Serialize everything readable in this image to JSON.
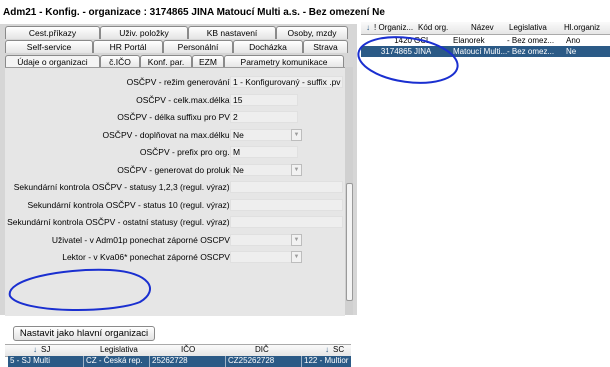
{
  "window": {
    "title": "Adm21 - Konfig. - organizace : 3174865  JINA    Matoucí Multi a.s.    - Bez omezení   Ne"
  },
  "tabs": {
    "row1": [
      "Cest.příkazy",
      "Uživ. položky",
      "KB nastavení",
      "Osoby, mzdy"
    ],
    "row2": [
      "Self-service",
      "HR Portál",
      "Personální",
      "Docházka",
      "Strava"
    ],
    "row3": [
      "Údaje o organizaci",
      "č.IČO",
      "Konf. par.",
      "EZM",
      "Parametry komunikace"
    ]
  },
  "form": {
    "fields": [
      {
        "label": "OSČPV - režim generování:",
        "value": "1 - Konfigurovaný - suffix .pv",
        "type": "text-wide"
      },
      {
        "label": "OSČPV - celk.max.délka:",
        "value": "15",
        "type": "text"
      },
      {
        "label": "OSČPV - délka suffixu pro PV:",
        "value": "2",
        "type": "text"
      },
      {
        "label": "OSČPV - doplňovat na max.délku:",
        "value": "Ne",
        "type": "select"
      },
      {
        "label": "OSČPV - prefix pro org.:",
        "value": "M",
        "type": "text"
      },
      {
        "label": "OSČPV - generovat do proluk:",
        "value": "Ne",
        "type": "select"
      },
      {
        "label": "Sekundární kontrola OSČPV - statusy 1,2,3 (regul. výraz):",
        "value": "",
        "type": "text-wide"
      },
      {
        "label": "Sekundární kontrola OSČPV - status 10 (regul. výraz):",
        "value": "",
        "type": "text-wide"
      },
      {
        "label": "Sekundární kontrola OSČPV - ostatní statusy (regul. výraz):",
        "value": "",
        "type": "text-wide"
      },
      {
        "label": "Uživatel - v Adm01p ponechat záporné OSCPV:",
        "value": "",
        "type": "select"
      },
      {
        "label": "Lektor - v Kva06* ponechat záporné OSCPV:",
        "value": "",
        "type": "select"
      }
    ],
    "main_org_button": "Nastavit jako hlavní organizaci"
  },
  "sj_grid": {
    "columns": [
      "SJ",
      "Legislativa",
      "IČO",
      "DIČ",
      "SC"
    ],
    "rows": [
      [
        "5 - SJ Multi",
        "CZ - Česká rep.",
        "25262728",
        "CZ25262728",
        "122 - Multior"
      ]
    ]
  },
  "org_grid": {
    "columns": [
      "! Organiz...",
      "Kód org.",
      "Název",
      "Legislativa",
      "Hl.organiz"
    ],
    "rows": [
      [
        "1420",
        "GCL",
        "Elanorek",
        "- Bez omez...",
        "Ano"
      ],
      [
        "3174865",
        "JINA",
        "Matoucí Multi...",
        "- Bez omez...",
        "Ne"
      ]
    ],
    "selected_index": 1
  },
  "colors": {
    "selection": "#2b5a86",
    "annotation": "#1a2fd0",
    "panel": "#e6e6e6"
  }
}
